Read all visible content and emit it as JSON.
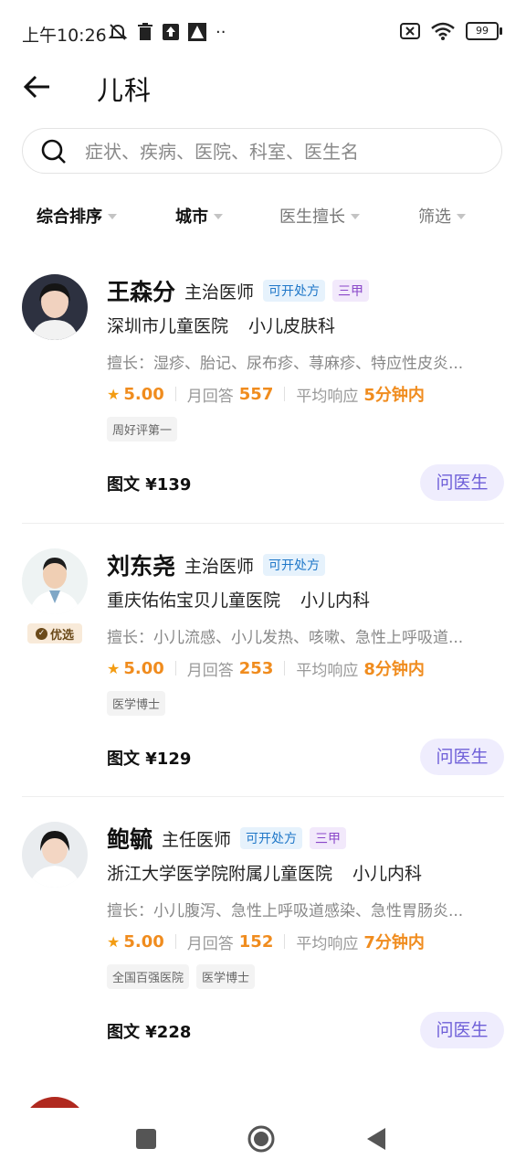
{
  "status": {
    "time": "上午10:26",
    "battery": "99"
  },
  "header": {
    "title": "儿科"
  },
  "search": {
    "placeholder": "症状、疾病、医院、科室、医生名"
  },
  "filters": [
    "综合排序",
    "城市",
    "医生擅长",
    "筛选"
  ],
  "labels": {
    "monthly_prefix": "月回答",
    "avg_prefix": "平均响应",
    "ask": "问医生",
    "youxuan": "优选"
  },
  "doctors": [
    {
      "name": "王森分",
      "title": "主治医师",
      "rx_tag": "可开处方",
      "level_tag": "三甲",
      "hospital": "深圳市儿童医院",
      "dept": "小儿皮肤科",
      "skill": "擅长：湿疹、胎记、尿布疹、荨麻疹、特应性皮炎...",
      "rating": "5.00",
      "monthly": "557",
      "response": "5分钟内",
      "badges": [
        "周好评第一"
      ],
      "price": "图文 ¥139"
    },
    {
      "name": "刘东尧",
      "title": "主治医师",
      "rx_tag": "可开处方",
      "level_tag": "",
      "hospital": "重庆佑佑宝贝儿童医院",
      "dept": "小儿内科",
      "skill": "擅长：小儿流感、小儿发热、咳嗽、急性上呼吸道...",
      "rating": "5.00",
      "monthly": "253",
      "response": "8分钟内",
      "badges": [
        "医学博士"
      ],
      "price": "图文 ¥129"
    },
    {
      "name": "鲍毓",
      "title": "主任医师",
      "rx_tag": "可开处方",
      "level_tag": "三甲",
      "hospital": "浙江大学医学院附属儿童医院",
      "dept": "小儿内科",
      "skill": "擅长：小儿腹泻、急性上呼吸道感染、急性胃肠炎...",
      "rating": "5.00",
      "monthly": "152",
      "response": "7分钟内",
      "badges": [
        "全国百强医院",
        "医学博士"
      ],
      "price": "图文 ¥228"
    }
  ],
  "colors": {
    "accent_purple": "#6e5fd8",
    "orange": "#f08c1e",
    "rx_blue": "#1f77c8"
  }
}
